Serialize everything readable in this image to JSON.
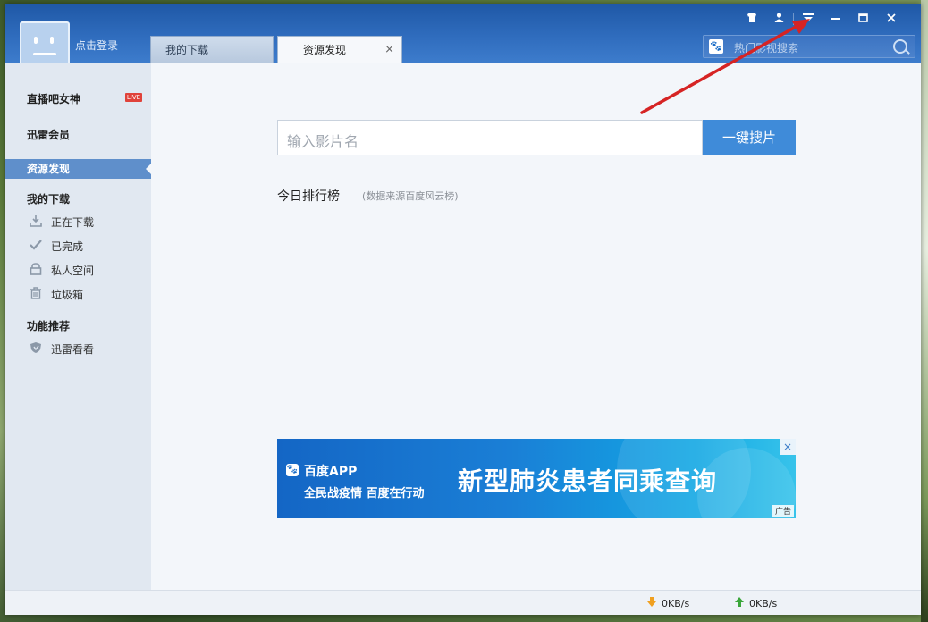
{
  "user": {
    "login_label": "点击登录"
  },
  "tabs": [
    {
      "label": "我的下载"
    },
    {
      "label": "资源发现",
      "close": "×"
    }
  ],
  "window_controls": {
    "skin": "skin-icon",
    "user": "user-icon",
    "menu": "menu-icon",
    "minimize": "minimize-icon",
    "maximize": "maximize-icon",
    "close": "close-icon"
  },
  "top_search": {
    "placeholder": "热门影视搜索"
  },
  "sidebar": {
    "live_item": {
      "label": "直播吧女神",
      "badge": "LIVE"
    },
    "vip": {
      "label": "迅雷会员"
    },
    "active": {
      "label": "资源发现"
    },
    "downloads_header": "我的下载",
    "downloads": [
      {
        "label": "正在下载",
        "icon": "download-icon"
      },
      {
        "label": "已完成",
        "icon": "check-icon"
      },
      {
        "label": "私人空间",
        "icon": "lock-icon"
      },
      {
        "label": "垃圾箱",
        "icon": "trash-icon"
      }
    ],
    "features_header": "功能推荐",
    "features": [
      {
        "label": "迅雷看看",
        "icon": "shield-icon"
      }
    ]
  },
  "main": {
    "search_placeholder": "输入影片名",
    "search_button": "一键搜片",
    "rank_title": "今日排行榜",
    "rank_source": "(数据来源百度风云榜)"
  },
  "ad": {
    "brand": "百度APP",
    "slogan": "全民战疫情 百度在行动",
    "headline": "新型肺炎患者同乘查询",
    "tag": "广告",
    "close": "×"
  },
  "status": {
    "download_speed": "0KB/s",
    "upload_speed": "0KB/s"
  },
  "colors": {
    "title_bar": "#2f6cbd",
    "active_nav": "#5f8fcb",
    "accent_button": "#3f8bd9",
    "arrow": "#d62424"
  }
}
